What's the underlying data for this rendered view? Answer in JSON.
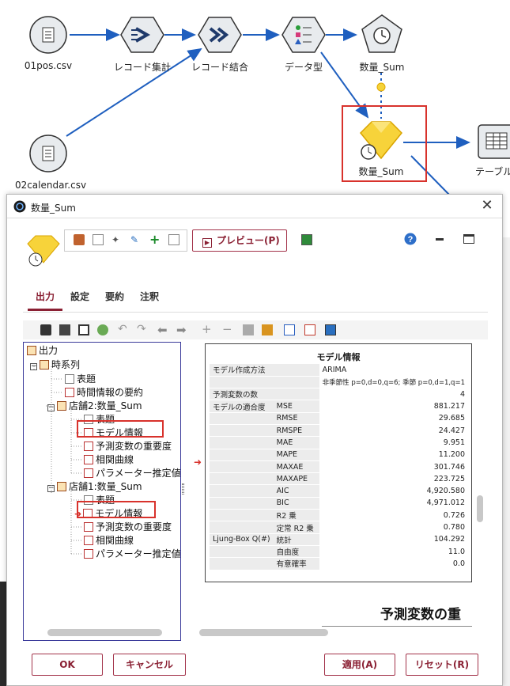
{
  "canvas": {
    "nodes": {
      "pos_csv": "01pos.csv",
      "record_agg": "レコード集計",
      "record_merge": "レコード結合",
      "data_type": "データ型",
      "sum_top": "数量_Sum",
      "sum_model": "数量_Sum",
      "calendar_csv": "02calendar.csv",
      "table": "テーブル"
    }
  },
  "dialog": {
    "title": "数量_Sum",
    "preview_label": "プレビュー(P)",
    "help_icon": "help-icon",
    "tabs": [
      "出力",
      "設定",
      "要約",
      "注釈"
    ],
    "tree": {
      "root": "出力",
      "time_series": "時系列",
      "items": [
        {
          "label": "表題"
        },
        {
          "label": "時間情報の要約"
        },
        {
          "label": "店舗2:数量_Sum"
        },
        {
          "label": "表題"
        },
        {
          "label": "モデル情報"
        },
        {
          "label": "予測変数の重要度"
        },
        {
          "label": "相関曲線"
        },
        {
          "label": "パラメーター推定値"
        },
        {
          "label": "店舗1:数量_Sum"
        },
        {
          "label": "表題"
        },
        {
          "label": "モデル情報"
        },
        {
          "label": "予測変数の重要度"
        },
        {
          "label": "相関曲線"
        },
        {
          "label": "パラメーター推定値"
        }
      ]
    },
    "model_info": {
      "title": "モデル情報",
      "rows": [
        {
          "a": "モデル作成方法",
          "b": "",
          "v": "ARIMA"
        },
        {
          "a": "",
          "b": "",
          "v": "非季節性 p=0,d=0,q=6; 季節 p=0,d=1,q=1"
        },
        {
          "a": "予測変数の数",
          "b": "",
          "v": "4"
        },
        {
          "a": "モデルの適合度",
          "b": "MSE",
          "v": "881.217"
        },
        {
          "a": "",
          "b": "RMSE",
          "v": "29.685"
        },
        {
          "a": "",
          "b": "RMSPE",
          "v": "24.427"
        },
        {
          "a": "",
          "b": "MAE",
          "v": "9.951"
        },
        {
          "a": "",
          "b": "MAPE",
          "v": "11.200"
        },
        {
          "a": "",
          "b": "MAXAE",
          "v": "301.746"
        },
        {
          "a": "",
          "b": "MAXAPE",
          "v": "223.725"
        },
        {
          "a": "",
          "b": "AIC",
          "v": "4,920.580"
        },
        {
          "a": "",
          "b": "BIC",
          "v": "4,971.012"
        },
        {
          "a": "",
          "b": "R2 乗",
          "v": "0.726"
        },
        {
          "a": "",
          "b": "定常 R2 乗",
          "v": "0.780"
        },
        {
          "a": "Ljung-Box Q(#)",
          "b": "統計",
          "v": "104.292"
        },
        {
          "a": "",
          "b": "自由度",
          "v": "11.0"
        },
        {
          "a": "",
          "b": "有意確率",
          "v": "0.0"
        }
      ]
    },
    "next_heading": "予測変数の重",
    "buttons": {
      "ok": "OK",
      "cancel": "キャンセル",
      "apply": "適用(A)",
      "reset": "リセット(R)"
    }
  },
  "colors": {
    "accent": "#8a2033",
    "highlight": "#d8322c",
    "stream_arrow": "#1f5fbf",
    "node_fill": "#e8ebee",
    "model_gem": "#f7d33a"
  }
}
